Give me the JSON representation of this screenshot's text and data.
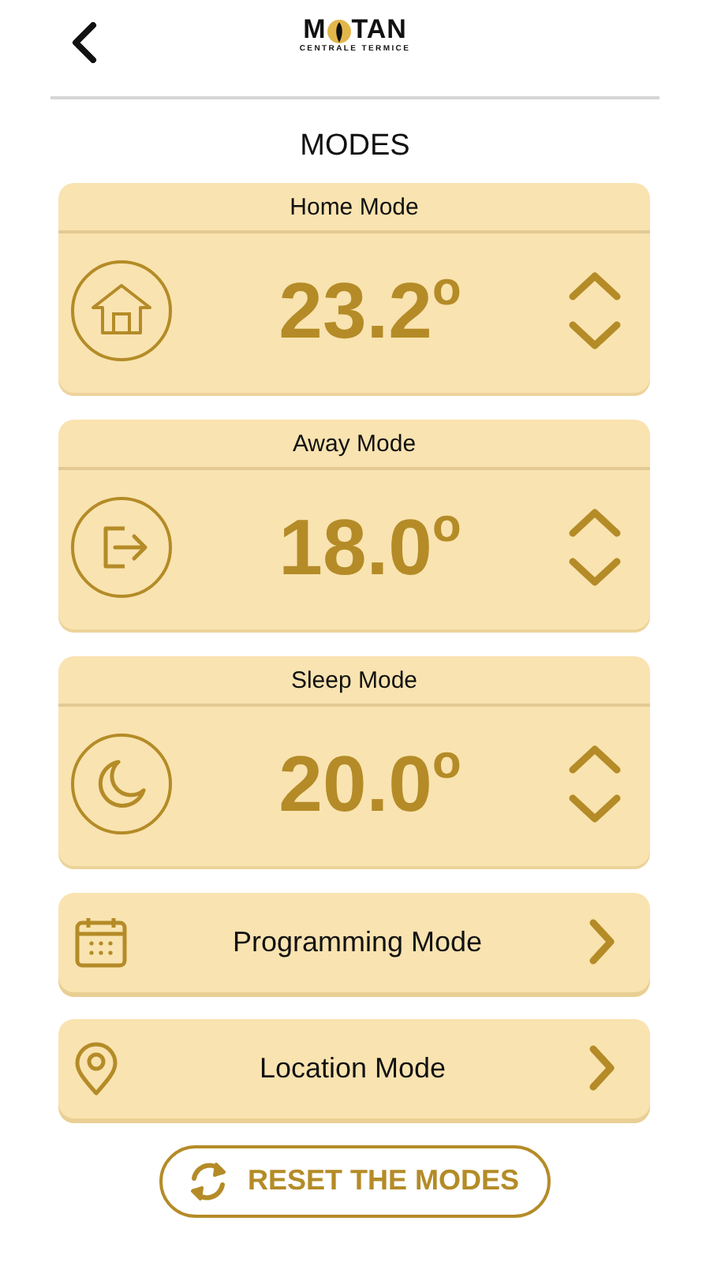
{
  "header": {
    "logo": {
      "left": "M",
      "right": "TAN",
      "tagline": "CENTRALE TERMICE"
    }
  },
  "title": "MODES",
  "modes": [
    {
      "kind": "home",
      "name": "Home Mode",
      "temperature": "23.2$^{o}$"
    },
    {
      "kind": "away",
      "name": "Away Mode",
      "temperature": "18.0$^{o}$"
    },
    {
      "kind": "sleep",
      "name": "Sleep Mode",
      "temperature": "20.0$^{o}$"
    }
  ],
  "links": [
    {
      "kind": "calendar",
      "label": "Programming Mode"
    },
    {
      "kind": "location",
      "label": "Location Mode"
    }
  ],
  "reset_button": "RESET THE MODES"
}
